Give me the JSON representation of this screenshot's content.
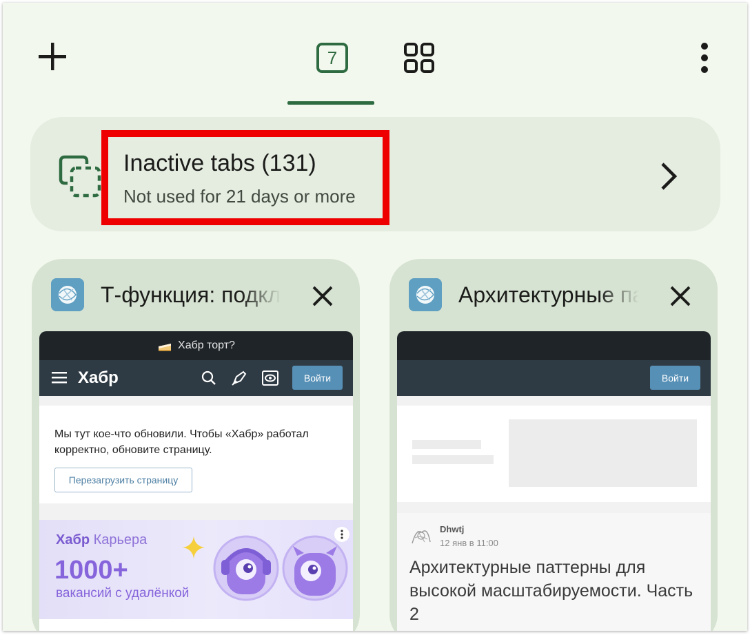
{
  "toolbar": {
    "add_icon": "plus-icon",
    "tab_count": "7",
    "grid_icon": "tab-groups-icon",
    "menu_icon": "more-vert-icon"
  },
  "inactive_tabs": {
    "title": "Inactive tabs (131)",
    "subtitle": "Not used for 21 days or more",
    "highlight_color": "#ee0000"
  },
  "tabs": [
    {
      "title": "Т-функция: подключ",
      "favicon": "habr-favicon",
      "thumbnail": {
        "banner_text": "Хабр торт?",
        "logo": "Хабр",
        "login": "Войти",
        "message": "Мы тут кое-что обновили. Чтобы «Хабр» работал корректно, обновите страницу.",
        "reload_button": "Перезагрузить страницу",
        "ad_brand_bold": "Хабр",
        "ad_brand": "Карьера",
        "ad_big": "1000+",
        "ad_small": "вакансий с удалёнкой"
      }
    },
    {
      "title": "Архитектурные паттерны",
      "favicon": "habr-favicon",
      "thumbnail": {
        "login": "Войти",
        "author": "Dhwtj",
        "date": "12 янв в 11:00",
        "post_title": "Архитектурные паттерны для высокой масштабируемости. Часть 2"
      }
    }
  ],
  "colors": {
    "background": "#f3f8ee",
    "accent": "#2e6b41",
    "card": "#d7e3d2",
    "inactive_card": "#e5ece0"
  }
}
